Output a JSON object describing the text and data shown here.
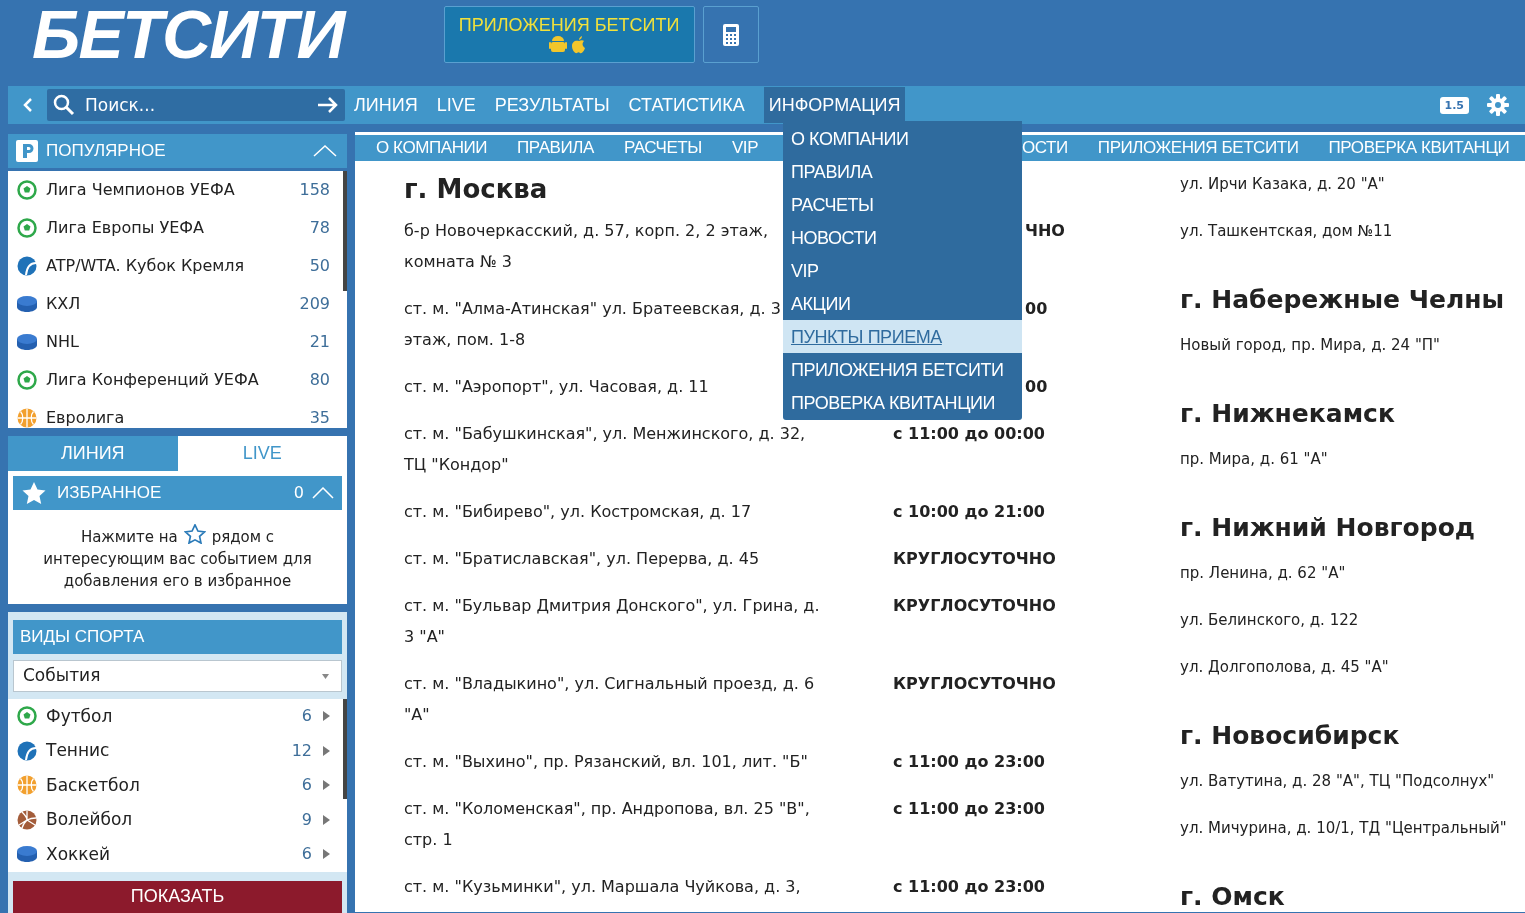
{
  "header": {
    "logo": "БЕТСИТИ",
    "apps_button": "ПРИЛОЖЕНИЯ БЕТСИТИ"
  },
  "search": {
    "placeholder": "Поиск..."
  },
  "nav": [
    {
      "label": "ЛИНИЯ",
      "selected": false
    },
    {
      "label": "LIVE",
      "selected": false
    },
    {
      "label": "РЕЗУЛЬТАТЫ",
      "selected": false
    },
    {
      "label": "СТАТИСТИКА",
      "selected": false
    },
    {
      "label": "ИНФОРМАЦИЯ",
      "selected": true
    }
  ],
  "odds_badge": "1.5",
  "dropdown": [
    {
      "label": "О КОМПАНИИ",
      "selected": false
    },
    {
      "label": "ПРАВИЛА",
      "selected": false
    },
    {
      "label": "РАСЧЕТЫ",
      "selected": false
    },
    {
      "label": "НОВОСТИ",
      "selected": false
    },
    {
      "label": "VIP",
      "selected": false
    },
    {
      "label": "АКЦИИ",
      "selected": false
    },
    {
      "label": "ПУНКТЫ ПРИЕМА",
      "selected": true
    },
    {
      "label": "ПРИЛОЖЕНИЯ БЕТСИТИ",
      "selected": false
    },
    {
      "label": "ПРОВЕРКА КВИТАНЦИИ",
      "selected": false
    }
  ],
  "sidebar": {
    "popular": {
      "title": "ПОПУЛЯРНОЕ",
      "items": [
        {
          "kind": "football",
          "name": "Лига Чемпионов УЕФА",
          "count": "158"
        },
        {
          "kind": "football",
          "name": "Лига Европы УЕФА",
          "count": "78"
        },
        {
          "kind": "tennis",
          "name": "ATP/WTA. Кубок Кремля",
          "count": "50"
        },
        {
          "kind": "hockey",
          "name": "КХЛ",
          "count": "209"
        },
        {
          "kind": "hockey",
          "name": "NHL",
          "count": "21"
        },
        {
          "kind": "football",
          "name": "Лига Конференций УЕФА",
          "count": "80"
        },
        {
          "kind": "basketball",
          "name": "Евролига",
          "count": "35"
        }
      ]
    },
    "tabs": [
      {
        "label": "ЛИНИЯ",
        "selected": true
      },
      {
        "label": "LIVE",
        "selected": false
      }
    ],
    "favorites": {
      "title": "ИЗБРАННОЕ",
      "count": "0",
      "hint_before": "Нажмите на",
      "hint_after": "рядом с",
      "hint_rest": "интересующим вас событием для добавления его в избранное"
    },
    "sports": {
      "title": "ВИДЫ СПОРТА",
      "select": "События",
      "items": [
        {
          "kind": "football",
          "name": "Футбол",
          "count": "6"
        },
        {
          "kind": "tennis",
          "name": "Теннис",
          "count": "12"
        },
        {
          "kind": "basketball",
          "name": "Баскетбол",
          "count": "6"
        },
        {
          "kind": "volleyball",
          "name": "Волейбол",
          "count": "9"
        },
        {
          "kind": "hockey",
          "name": "Хоккей",
          "count": "6"
        }
      ]
    },
    "show_button": "ПОКАЗАТЬ"
  },
  "subtabs": [
    {
      "label": "О КОМПАНИИ",
      "kind": "full"
    },
    {
      "label": "ПРАВИЛА",
      "kind": "full"
    },
    {
      "label": "РАСЧЕТЫ",
      "kind": "full"
    },
    {
      "label": "VIP",
      "kind": "full"
    },
    {
      "label": "ОСТИ",
      "kind": "cut"
    },
    {
      "label": "ПРИЛОЖЕНИЯ БЕТСИТИ",
      "kind": "full"
    },
    {
      "label": "ПРОВЕРКА КВИТАНЦИ",
      "kind": "full"
    }
  ],
  "moscow": {
    "city": "г. Москва",
    "points": [
      {
        "address": [
          "б-р Новочеркасский, д. 57, корп. 2, 2 этаж,",
          "комната № 3"
        ],
        "hours": "ЧНО",
        "kind": "cut"
      },
      {
        "address": [
          "ст. м. \"Алма-Атинская\" ул. Братеевская, д. 3",
          "этаж, пом. 1-8"
        ],
        "hours": "00",
        "kind": "cut"
      },
      {
        "address": [
          "ст. м. \"Аэропорт\", ул. Часовая, д. 11"
        ],
        "hours": "00",
        "kind": "cut"
      },
      {
        "address": [
          "ст. м. \"Бабушкинская\", ул. Менжинского, д. 32,",
          "ТЦ \"Кондор\""
        ],
        "hours": "с 11:00 до 00:00",
        "kind": "full"
      },
      {
        "address": [
          "ст. м. \"Бибирево\", ул. Костромская, д. 17"
        ],
        "hours": "с 10:00 до 21:00",
        "kind": "full"
      },
      {
        "address": [
          "ст. м. \"Братиславская\", ул. Перерва, д. 45"
        ],
        "hours": "КРУГЛОСУТОЧНО",
        "kind": "full"
      },
      {
        "address": [
          "ст. м. \"Бульвар Дмитрия Донского\", ул. Грина, д.",
          "3 \"А\""
        ],
        "hours": "КРУГЛОСУТОЧНО",
        "kind": "full"
      },
      {
        "address": [
          "ст. м. \"Владыкино\", ул. Сигнальный проезд, д. 6",
          "\"А\""
        ],
        "hours": "КРУГЛОСУТОЧНО",
        "kind": "full"
      },
      {
        "address": [
          "ст. м. \"Выхино\", пр. Рязанский, вл. 101, лит. \"Б\""
        ],
        "hours": "с 11:00 до 23:00",
        "kind": "full"
      },
      {
        "address": [
          "ст. м. \"Коломенская\", пр. Андропова, вл. 25 \"В\",",
          "стр. 1"
        ],
        "hours": "с 11:00 до 23:00",
        "kind": "full"
      },
      {
        "address": [
          "ст. м. \"Кузьминки\", ул. Маршала Чуйкова, д. 3,"
        ],
        "hours": "с 11:00 до 23:00",
        "kind": "full"
      }
    ]
  },
  "right_column": [
    {
      "addresses": [
        "ул. Ирчи Казака, д. 20 \"А\"",
        "ул. Ташкентская, дом №11"
      ]
    },
    {
      "city": "г. Набережные Челны",
      "addresses": [
        "Новый город, пр. Мира, д. 24 \"П\""
      ]
    },
    {
      "city": "г. Нижнекамск",
      "addresses": [
        "пр. Мира, д. 61 \"А\""
      ]
    },
    {
      "city": "г. Нижний Новгород",
      "addresses": [
        "пр. Ленина, д. 62 \"А\"",
        "ул. Белинского, д. 122",
        "ул. Долгополова, д. 45 \"А\""
      ]
    },
    {
      "city": "г. Новосибирск",
      "addresses": [
        "ул. Ватутина, д. 28 \"А\", ТЦ \"Подсолнух\"",
        "ул. Мичурина, д. 10/1, ТД \"Центральный\""
      ]
    },
    {
      "city": "г. Омск"
    }
  ]
}
